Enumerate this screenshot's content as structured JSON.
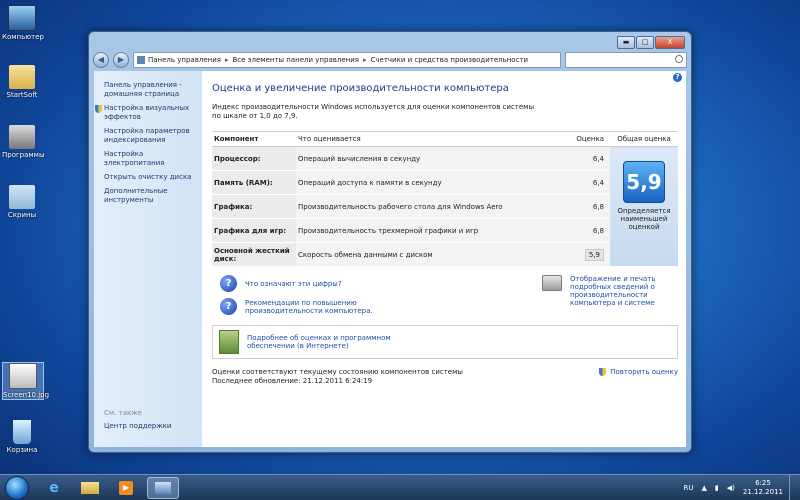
{
  "desktop": {
    "icons": [
      {
        "label": "Компьютер"
      },
      {
        "label": "StartSoft"
      },
      {
        "label": "Программы"
      },
      {
        "label": "Скрины"
      },
      {
        "label": "Screen10.jpg"
      },
      {
        "label": "Корзина"
      }
    ]
  },
  "window": {
    "controls": {
      "minimize": "▬",
      "maximize": "□",
      "close": "X"
    },
    "address": {
      "crumbs": [
        "Панель управления",
        "Все элементы панели управления",
        "Счетчики и средства производительности"
      ]
    },
    "sidebar": {
      "items": [
        {
          "label": "Панель управления - домашняя страница"
        },
        {
          "label": "Настройка визуальных эффектов"
        },
        {
          "label": "Настройка параметров индексирования"
        },
        {
          "label": "Настройка электропитания"
        },
        {
          "label": "Открыть очистку диска"
        },
        {
          "label": "Дополнительные инструменты"
        }
      ],
      "see_also": "См. также",
      "support": "Центр поддержки"
    },
    "main": {
      "title": "Оценка и увеличение производительности компьютера",
      "intro": "Индекс производительности Windows используется для оценки компонентов системы по шкале от 1,0 до 7,9.",
      "table": {
        "headers": {
          "component": "Компонент",
          "what": "Что оценивается",
          "score": "Оценка",
          "overall": "Общая оценка"
        },
        "rows": [
          {
            "component": "Процессор:",
            "what": "Операций вычисления в секунду",
            "score": "6,4"
          },
          {
            "component": "Память (RAM):",
            "what": "Операций доступа к памяти в секунду",
            "score": "6,4"
          },
          {
            "component": "Графика:",
            "what": "Производительность рабочего стола для Windows Aero",
            "score": "6,8"
          },
          {
            "component": "Графика для игр:",
            "what": "Производительность трехмерной графики и игр",
            "score": "6,8"
          },
          {
            "component": "Основной жесткий диск:",
            "what": "Скорость обмена данными с диском",
            "score": "5,9"
          }
        ],
        "overall_score": "5,9",
        "overall_caption": "Определяется наименьшей оценкой"
      },
      "links": {
        "what_mean": "Что означают эти цифры?",
        "tips": "Рекомендации по повышению производительности компьютера.",
        "print": "Отображение и печать подробных сведений о производительности компьютера и системе",
        "online": "Подробнее об оценках и программном обеспечении (в Интернете)"
      },
      "status": {
        "current": "Оценки соответствуют текущему состоянию компонентов системы",
        "last_update": "Последнее обновление: 21.12.2011 6:24:19",
        "rerun": "Повторить оценку"
      }
    }
  },
  "taskbar": {
    "lang": "RU",
    "time": "6:25",
    "date": "21.12.2011"
  }
}
